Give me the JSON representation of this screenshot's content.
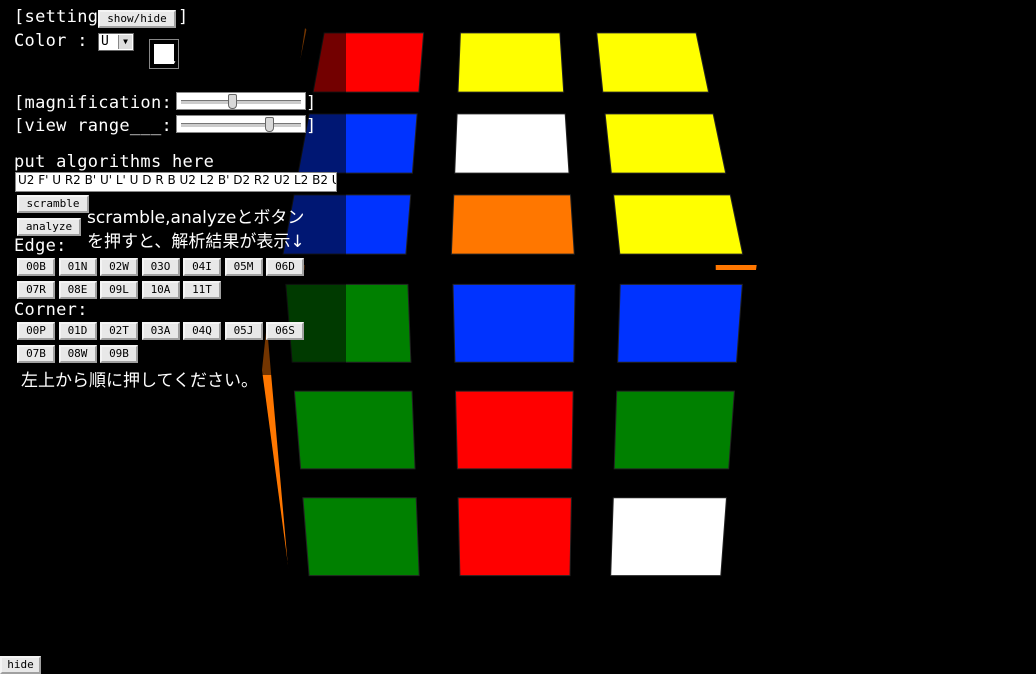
{
  "settings": {
    "title": "[setting",
    "toggle_label": "show/hide",
    "close_bracket": "]",
    "color_label": "Color :",
    "color_value": "U",
    "magnification_label": "[magnification:",
    "magnification_value": 0.42,
    "view_range_label": "[view range___:",
    "view_range_value": 0.74,
    "slider_close": "]"
  },
  "algorithm": {
    "label": "put algorithms here",
    "value": "U2 F' U R2 B' U' L' U D R B U2 L2 B' D2 R2 U2 L2 B2 U",
    "scramble_label": "scramble",
    "analyze_label": "analyze",
    "hint_line1": "scramble,analyzeとボタン",
    "hint_line2": "を押すと、解析結果が表示↓"
  },
  "edge": {
    "label": "Edge:",
    "buttons": [
      "00B",
      "01N",
      "02W",
      "03O",
      "04I",
      "05M",
      "06D",
      "07R",
      "08E",
      "09L",
      "10A",
      "11T"
    ]
  },
  "corner": {
    "label": "Corner:",
    "buttons": [
      "00P",
      "01D",
      "02T",
      "03A",
      "04Q",
      "05J",
      "06S",
      "07B",
      "08W",
      "09B"
    ],
    "instruction": "左上から順に押してください。"
  },
  "footer": {
    "hide_label": "hide"
  },
  "colors": {
    "red": "#ff0000",
    "yellow": "#ffff00",
    "white": "#ffffff",
    "blue": "#0033ff",
    "green": "#008000",
    "orange": "#ff7700",
    "black": "#000000"
  },
  "cube_faces": {
    "top": [
      "red",
      "yellow",
      "yellow",
      "blue",
      "white",
      "yellow",
      "blue",
      "orange",
      "yellow"
    ],
    "front": [
      "green",
      "blue",
      "blue",
      "green",
      "red",
      "green",
      "green",
      "red",
      "white"
    ],
    "right_strip": [
      "orange",
      "orange",
      "white",
      "white",
      "red"
    ]
  }
}
